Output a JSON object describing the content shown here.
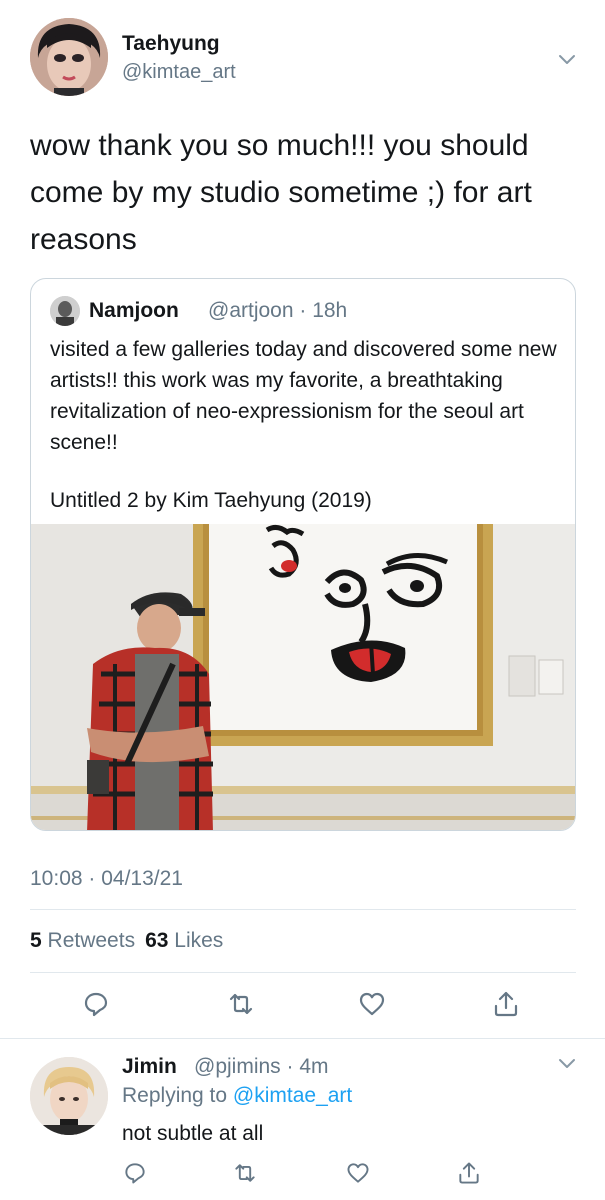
{
  "main_tweet": {
    "author_name": "Taehyung",
    "author_handle": "@kimtae_art",
    "text": "wow thank you so much!!! you should come by my studio sometime ;) for art reasons",
    "quote": {
      "author_name": "Namjoon",
      "author_handle_time": "@artjoon · 18h",
      "text": "visited a few galleries today and discovered some new artists!! this work was my favorite, a breathtaking revitalization of neo-expressionism for the seoul art scene!!",
      "caption": "Untitled 2 by Kim Taehyung (2019)"
    },
    "timestamp": "10:08 · 04/13/21",
    "retweets_count": "5",
    "retweets_label": "Retweets",
    "likes_count": "63",
    "likes_label": "Likes"
  },
  "reply": {
    "author_name": "Jimin",
    "author_handle_time": "@pjimins · 4m",
    "replying_prefix": "Replying to",
    "replying_handle": "@kimtae_art",
    "text": "not subtle at all"
  },
  "icons": [
    "reply-icon",
    "retweet-icon",
    "like-icon",
    "share-icon",
    "chevron-down-icon"
  ],
  "colors": {
    "text": "#14171a",
    "secondary": "#657786",
    "link": "#1da1f2",
    "border": "#e1e8ed"
  }
}
